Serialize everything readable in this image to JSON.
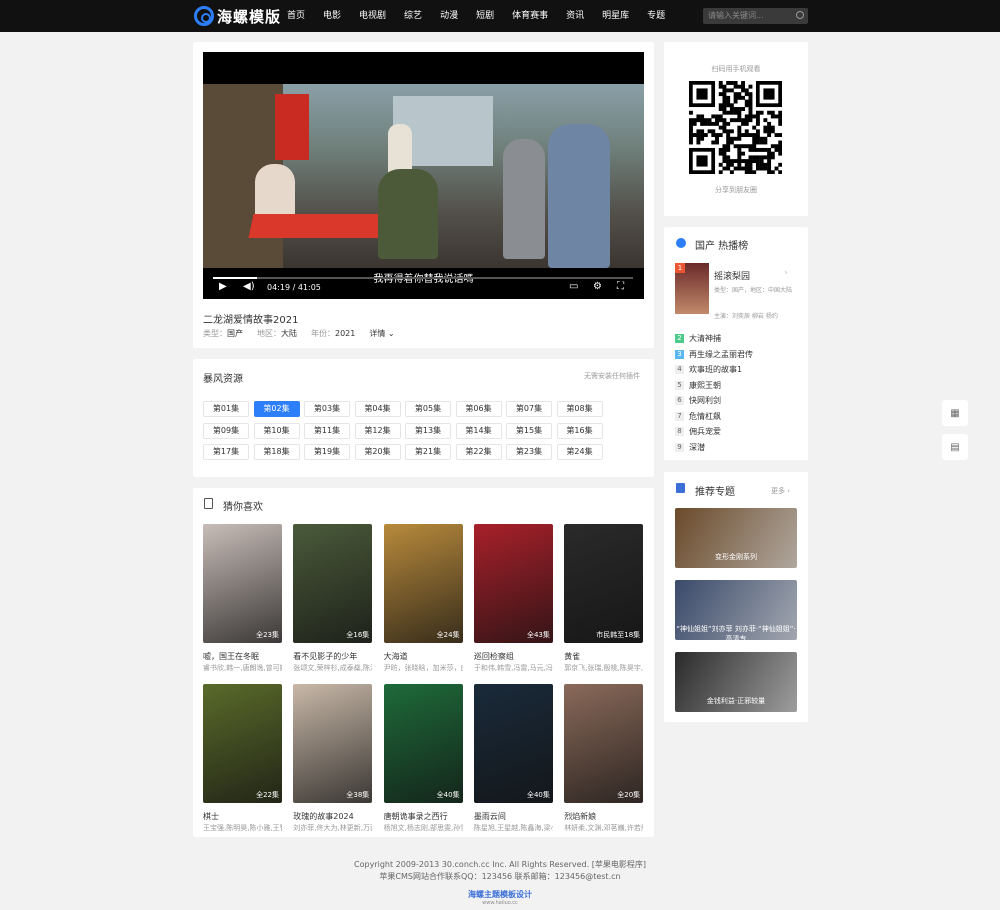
{
  "header": {
    "logo_text": "海螺模版",
    "nav": [
      "首页",
      "电影",
      "电视剧",
      "综艺",
      "动漫",
      "短剧",
      "体育赛事",
      "资讯",
      "明星库",
      "专题"
    ],
    "search_placeholder": "请输入关键词..."
  },
  "player": {
    "subtitle": "我再得着你替我说话嗎",
    "time": "04:19 / 41:05",
    "progress": 0.105
  },
  "video": {
    "title": "二龙湖爱情故事2021",
    "type_label": "类型：",
    "type": "国产",
    "area_label": "地区：",
    "area": "大陆",
    "year_label": "年份：",
    "year": "2021",
    "detail": "详情"
  },
  "source": {
    "title": "暴风资源",
    "note": "无需安装任何插件",
    "episodes": [
      "第01集",
      "第02集",
      "第03集",
      "第04集",
      "第05集",
      "第06集",
      "第07集",
      "第08集",
      "第09集",
      "第10集",
      "第11集",
      "第12集",
      "第13集",
      "第14集",
      "第15集",
      "第16集",
      "第17集",
      "第18集",
      "第19集",
      "第20集",
      "第21集",
      "第22集",
      "第23集",
      "第24集"
    ],
    "active": 1
  },
  "guess": {
    "title": "猜你喜欢",
    "items": [
      {
        "title": "嘘，国王在冬眠",
        "cast": "睿书欣,韩一,唐朗逸,曾可妮,",
        "badge": "全23集",
        "color": "#c8bdb8"
      },
      {
        "title": "看不见影子的少年",
        "cast": "张颂文,荣梓杉,成泰燊,陈海...",
        "badge": "全16集",
        "color": "#4a5a3a"
      },
      {
        "title": "大海道",
        "cast": "尹昉，张晓晗，加米莎，曲...",
        "badge": "全24集",
        "color": "#b88a3c"
      },
      {
        "title": "巡回检察组",
        "cast": "于和伟,韩雪,冯雷,马元,冯...",
        "badge": "全43集",
        "color": "#a8202a"
      },
      {
        "title": "黄雀",
        "cast": "郭京飞,张瑞,殷桃,陈昊宇,...",
        "badge": "市民韩至18集",
        "color": "#2a2a2a"
      },
      {
        "title": "棋士",
        "cast": "王宝强,陈明昊,陈小雅,王智...",
        "badge": "全22集",
        "color": "#5a6a2a"
      },
      {
        "title": "玫瑰的故事2024",
        "cast": "刘亦菲,佟大为,林更新,万茜...",
        "badge": "全38集",
        "color": "#c8b8a8"
      },
      {
        "title": "唐朝诡事录之西行",
        "cast": "杨旭文,杨志刚,郜思雯,孙雪...",
        "badge": "全40集",
        "color": "#1e6a3a"
      },
      {
        "title": "墨雨云间",
        "cast": "陈星旭,王星越,陈鑫海,梁小...",
        "badge": "全40集",
        "color": "#1a2a3a"
      },
      {
        "title": "烈焰新娘",
        "cast": "林妍柔,文渊,邓茗巍,许若彤...",
        "badge": "全20集",
        "color": "#8a6a5a"
      }
    ]
  },
  "qr": {
    "title": "扫码用手机观看",
    "share": "分享到朋友圈"
  },
  "hot": {
    "title": "国产 热播榜",
    "top": {
      "rank": "1",
      "name": "摇滚梨园",
      "type": "类型：国产，地区：中国大陆",
      "cast": "主演：刘奕辰 柳岩 杨约"
    },
    "list": [
      {
        "rank": "2",
        "name": "大清神捕"
      },
      {
        "rank": "3",
        "name": "再生缘之孟丽君传"
      },
      {
        "rank": "4",
        "name": "欢事班的故事1"
      },
      {
        "rank": "5",
        "name": "康熙王朝"
      },
      {
        "rank": "6",
        "name": "快网利剑"
      },
      {
        "rank": "7",
        "name": "危情杠飙"
      },
      {
        "rank": "8",
        "name": "佣兵宠爱"
      },
      {
        "rank": "9",
        "name": "深潜"
      }
    ]
  },
  "topics": {
    "title": "推荐专题",
    "more": "更多",
    "items": [
      {
        "caption": "变形金刚系列",
        "color": "#6a4a2a"
      },
      {
        "caption": "“神仙姐姐”刘亦菲  刘亦菲·“神仙姐姐”·高清专",
        "color": "#3a4a6a"
      },
      {
        "caption": "金钱利益·正邪较量",
        "color": "#2a2a2a"
      }
    ]
  },
  "footer": {
    "line1": "Copyright 2009-2013 30.conch.cc Inc. All Rights Reserved. [苹果电影程序]",
    "line2": "苹果CMS网站合作联系QQ：123456  联系邮箱：123456@test.cn",
    "brand": "海螺主题模板设计",
    "brand_sub": "www.hailuo.cc"
  },
  "colors": {
    "accent": "#2d7ff9",
    "header_bg": "#111111"
  }
}
